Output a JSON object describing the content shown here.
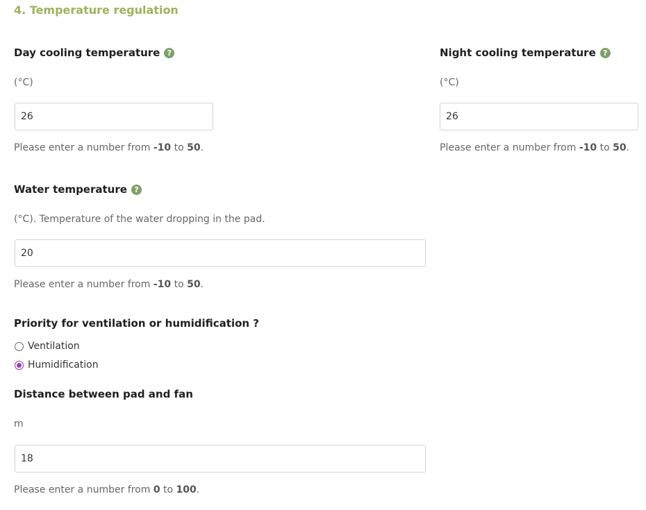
{
  "section": {
    "title": "4. Temperature regulation"
  },
  "day_cooling": {
    "label": "Day cooling temperature",
    "help_icon": "question-circle-icon",
    "unit": "(°C)",
    "value": "26",
    "hint_prefix": "Please enter a number from ",
    "min": "-10",
    "hint_mid": " to ",
    "max": "50",
    "hint_suffix": "."
  },
  "night_cooling": {
    "label": "Night cooling temperature",
    "help_icon": "question-circle-icon",
    "unit": "(°C)",
    "value": "26",
    "hint_prefix": "Please enter a number from ",
    "min": "-10",
    "hint_mid": " to ",
    "max": "50",
    "hint_suffix": "."
  },
  "water_temperature": {
    "label": "Water temperature",
    "help_icon": "question-circle-icon",
    "unit": "(°C). Temperature of the water dropping in the pad.",
    "value": "20",
    "hint_prefix": "Please enter a number from ",
    "min": "-10",
    "hint_mid": " to ",
    "max": "50",
    "hint_suffix": "."
  },
  "priority": {
    "label": "Priority for ventilation or humidification ?",
    "options": [
      {
        "label": "Ventilation",
        "checked": false
      },
      {
        "label": "Humidification",
        "checked": true
      }
    ]
  },
  "distance": {
    "label": "Distance between pad and fan",
    "unit": "m",
    "value": "18",
    "hint_prefix": "Please enter a number from ",
    "min": "0",
    "hint_mid": " to ",
    "max": "100",
    "hint_suffix": "."
  },
  "colors": {
    "section_title": "#9bb45a",
    "help_icon": "#7fa06a",
    "radio_checked": "#9b3bb8"
  }
}
